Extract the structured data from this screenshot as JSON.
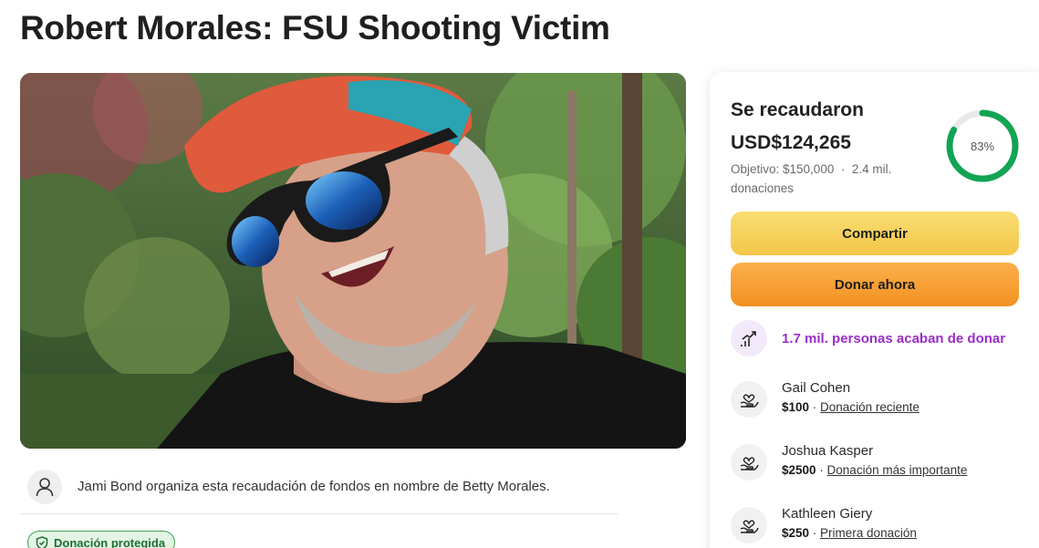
{
  "page": {
    "title": "Robert Morales: FSU Shooting Victim"
  },
  "organizer": {
    "text": "Jami Bond organiza esta recaudación de fondos en nombre de Betty Morales."
  },
  "badge": {
    "label": "Donación protegida"
  },
  "fundraiser": {
    "raised_label": "Se recaudaron",
    "raised_amount": "USD$124,265",
    "goal_text": "Objetivo: $150,000",
    "separator": "·",
    "donations_text": "2.4 mil. donaciones",
    "progress_percent": 83,
    "progress_label": "83%",
    "share_label": "Compartir",
    "donate_label": "Donar ahora",
    "trend_text": "1.7 mil. personas acaban de donar"
  },
  "donors": [
    {
      "name": "Gail Cohen",
      "amount": "$100",
      "sep": " · ",
      "type": "Donación reciente"
    },
    {
      "name": "Joshua Kasper",
      "amount": "$2500",
      "sep": " · ",
      "type": "Donación más importante"
    },
    {
      "name": "Kathleen Giery",
      "amount": "$250",
      "sep": " · ",
      "type": "Primera donación"
    }
  ],
  "colors": {
    "progress": "#12a454",
    "progress_track": "#e9e9e9",
    "trend": "#9a2ec7",
    "share": "#f6d25c",
    "donate": "#f6a236"
  }
}
